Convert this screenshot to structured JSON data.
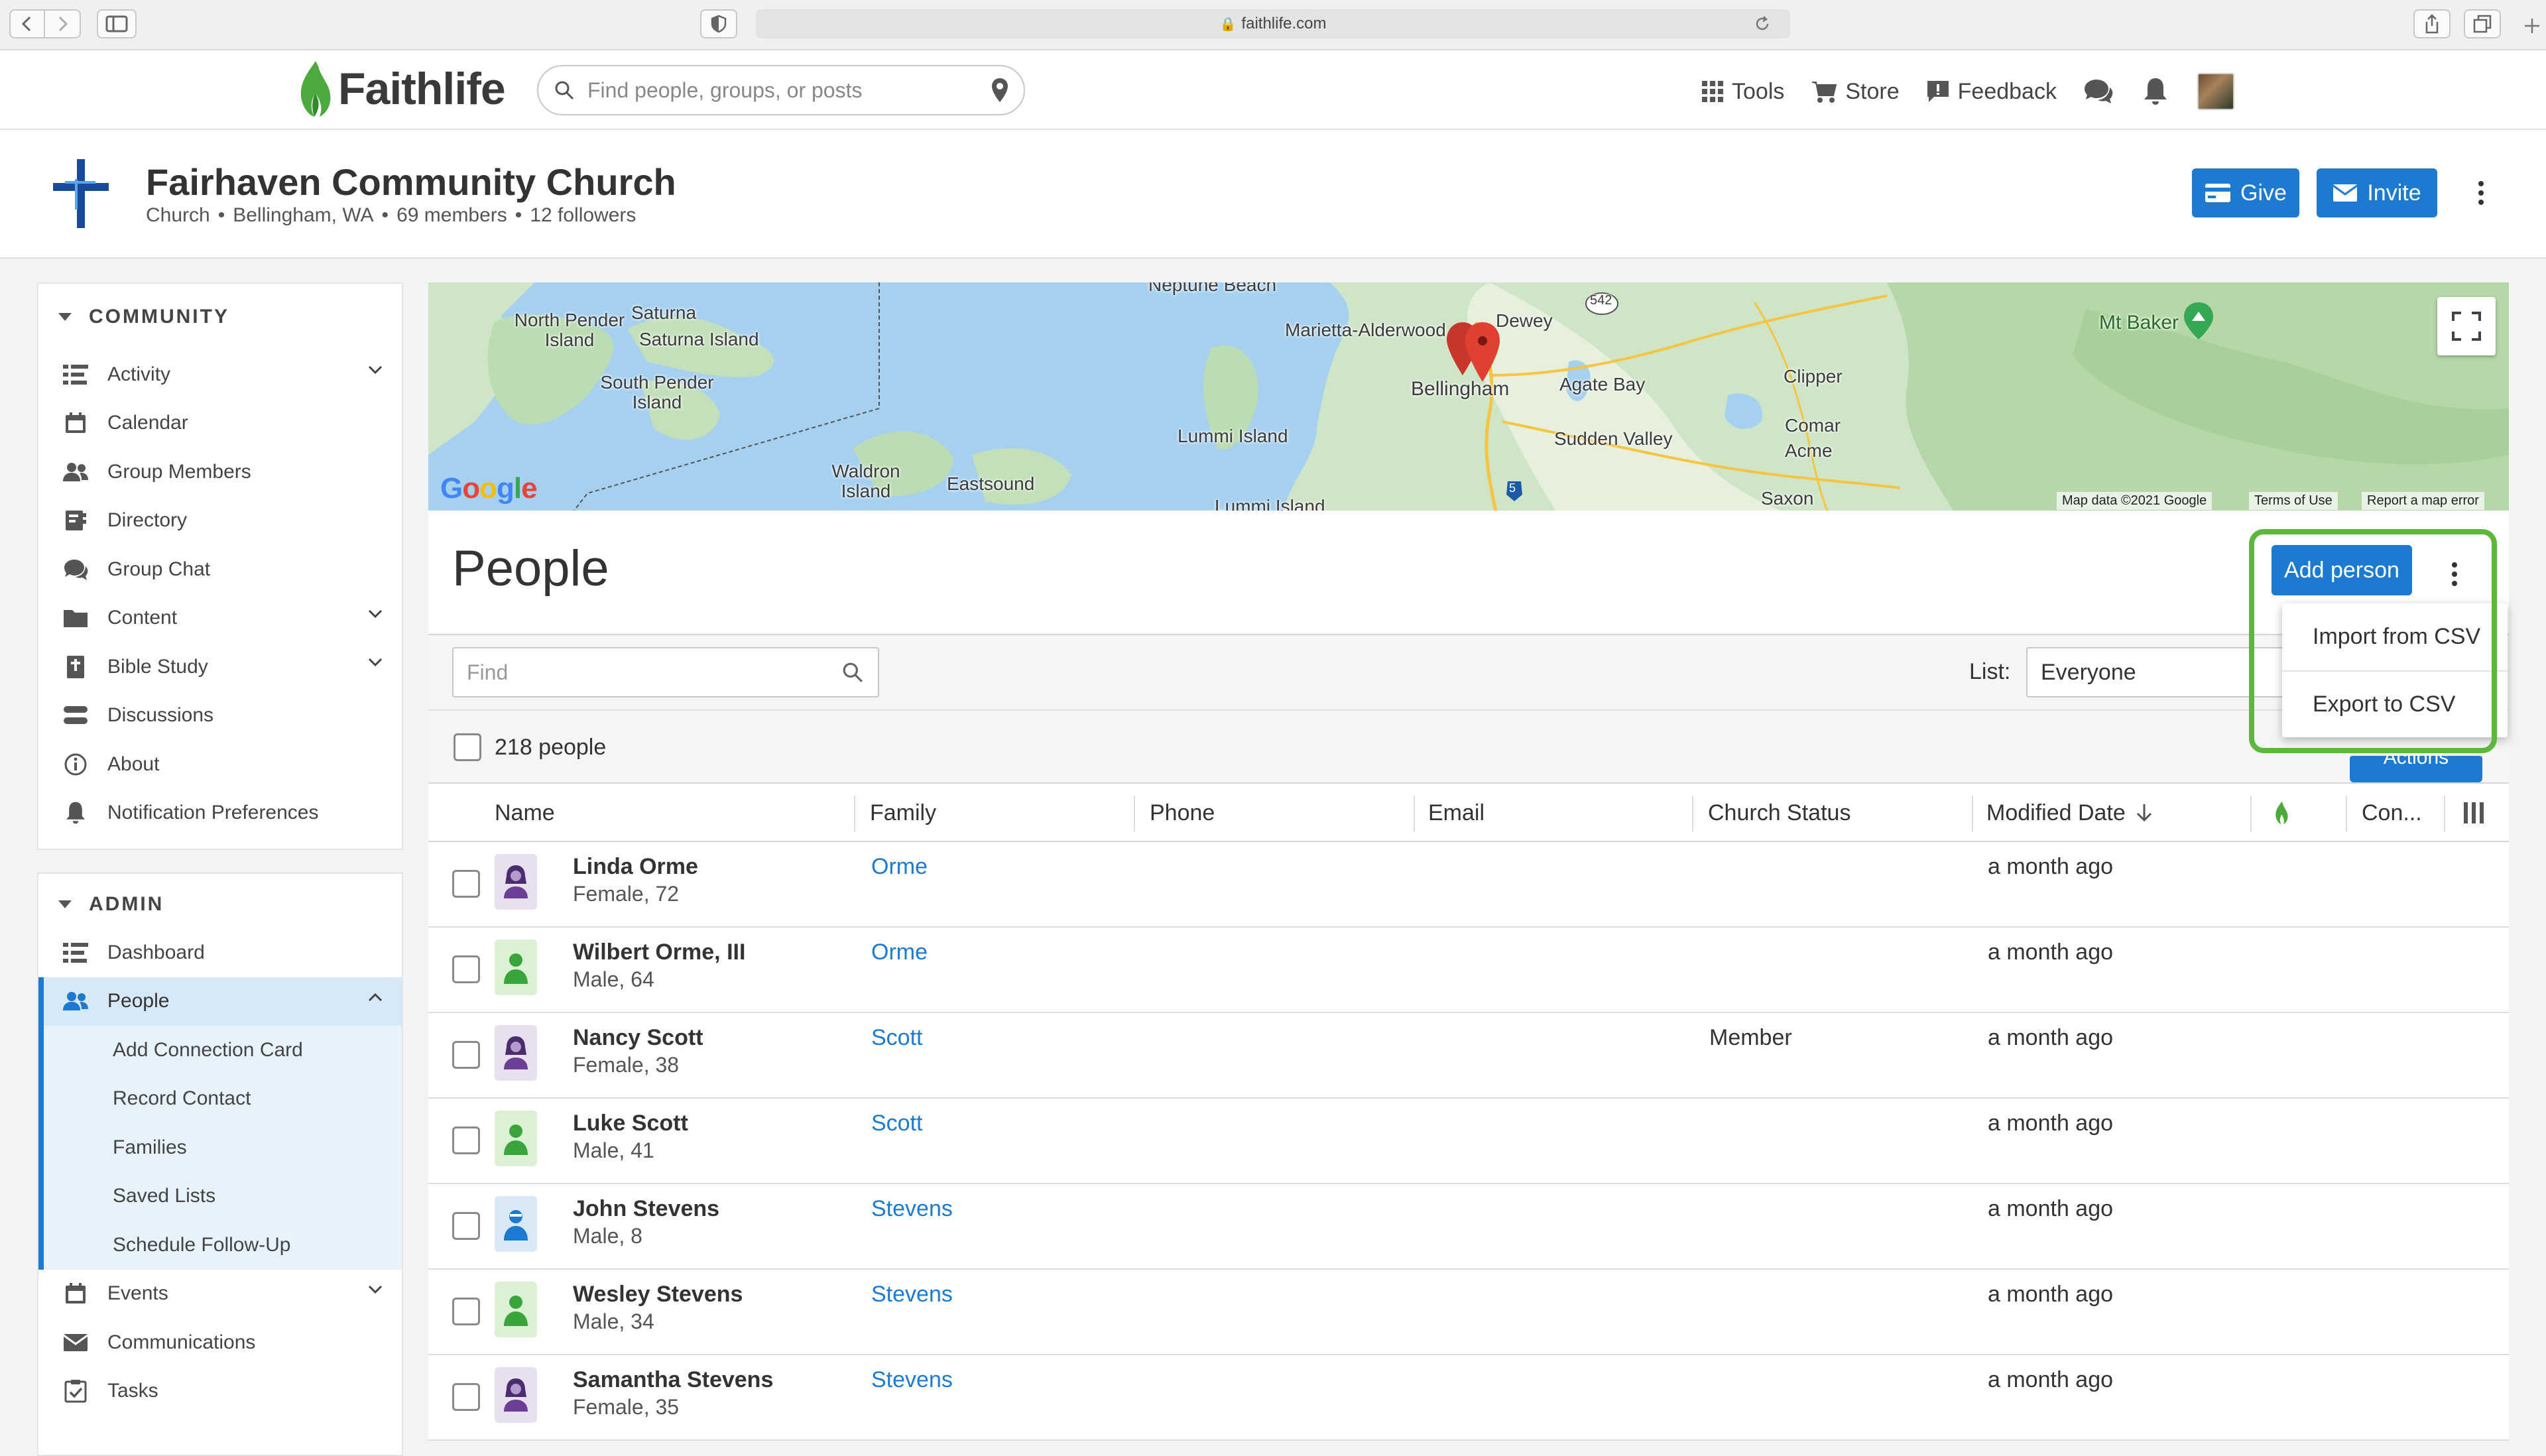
{
  "browser": {
    "url": "faithlife.com"
  },
  "header": {
    "brand": "Faithlife",
    "search_placeholder": "Find people, groups, or posts",
    "nav": {
      "tools": "Tools",
      "store": "Store",
      "feedback": "Feedback"
    }
  },
  "church": {
    "name": "Fairhaven Community Church",
    "type": "Church",
    "location": "Bellingham, WA",
    "members": "69 members",
    "followers": "12 followers",
    "give_label": "Give",
    "invite_label": "Invite"
  },
  "sidebar": {
    "community": {
      "heading": "COMMUNITY",
      "items": [
        {
          "label": "Activity"
        },
        {
          "label": "Calendar"
        },
        {
          "label": "Group Members"
        },
        {
          "label": "Directory"
        },
        {
          "label": "Group Chat"
        },
        {
          "label": "Content"
        },
        {
          "label": "Bible Study"
        },
        {
          "label": "Discussions"
        },
        {
          "label": "About"
        },
        {
          "label": "Notification Preferences"
        }
      ]
    },
    "admin": {
      "heading": "ADMIN",
      "items": [
        {
          "label": "Dashboard"
        },
        {
          "label": "People"
        },
        {
          "label": "Add Connection Card"
        },
        {
          "label": "Record Contact"
        },
        {
          "label": "Families"
        },
        {
          "label": "Saved Lists"
        },
        {
          "label": "Schedule Follow-Up"
        },
        {
          "label": "Events"
        },
        {
          "label": "Communications"
        },
        {
          "label": "Tasks"
        }
      ]
    }
  },
  "map": {
    "labels": {
      "neptune_beach": "Neptune Beach",
      "north_pender": "North Pender Island",
      "saturna": "Saturna",
      "saturna_island": "Saturna Island",
      "south_pender": "South Pender Island",
      "marietta": "Marietta-Alderwood",
      "dewey": "Dewey",
      "bellingham": "Bellingham",
      "agate_bay": "Agate Bay",
      "clipper": "Clipper",
      "mt_baker": "Mt Baker",
      "sudden_valley": "Sudden Valley",
      "comar": "Comar",
      "acme": "Acme",
      "lummi_island": "Lummi Island",
      "lummi_island_2": "Lummi Island",
      "waldron": "Waldron Island",
      "eastsound": "Eastsound",
      "saxon": "Saxon",
      "road_542": "542",
      "road_5": "5"
    },
    "attribution": "Map data ©2021 Google",
    "terms": "Terms of Use",
    "report": "Report a map error"
  },
  "people": {
    "title": "People",
    "add_label": "Add person",
    "find_placeholder": "Find",
    "list_label": "List:",
    "list_value": "Everyone",
    "count_text": "218 people",
    "actions_label": "Actions",
    "menu": {
      "import": "Import from CSV",
      "export": "Export to CSV"
    },
    "columns": {
      "name": "Name",
      "family": "Family",
      "phone": "Phone",
      "email": "Email",
      "church_status": "Church Status",
      "modified": "Modified Date",
      "con": "Con..."
    },
    "rows": [
      {
        "name": "Linda Orme",
        "desc": "Female, 72",
        "family": "Orme",
        "status": "",
        "modified": "a month ago"
      },
      {
        "name": "Wilbert Orme, III",
        "desc": "Male, 64",
        "family": "Orme",
        "status": "",
        "modified": "a month ago"
      },
      {
        "name": "Nancy Scott",
        "desc": "Female, 38",
        "family": "Scott",
        "status": "Member",
        "modified": "a month ago"
      },
      {
        "name": "Luke Scott",
        "desc": "Male, 41",
        "family": "Scott",
        "status": "",
        "modified": "a month ago"
      },
      {
        "name": "John Stevens",
        "desc": "Male, 8",
        "family": "Stevens",
        "status": "",
        "modified": "a month ago"
      },
      {
        "name": "Wesley Stevens",
        "desc": "Male, 34",
        "family": "Stevens",
        "status": "",
        "modified": "a month ago"
      },
      {
        "name": "Samantha Stevens",
        "desc": "Female, 35",
        "family": "Stevens",
        "status": "",
        "modified": "a month ago"
      }
    ]
  },
  "colors": {
    "accent": "#1c7ad0",
    "highlight": "#5bb83a",
    "active_bg": "#d7e8f6"
  }
}
